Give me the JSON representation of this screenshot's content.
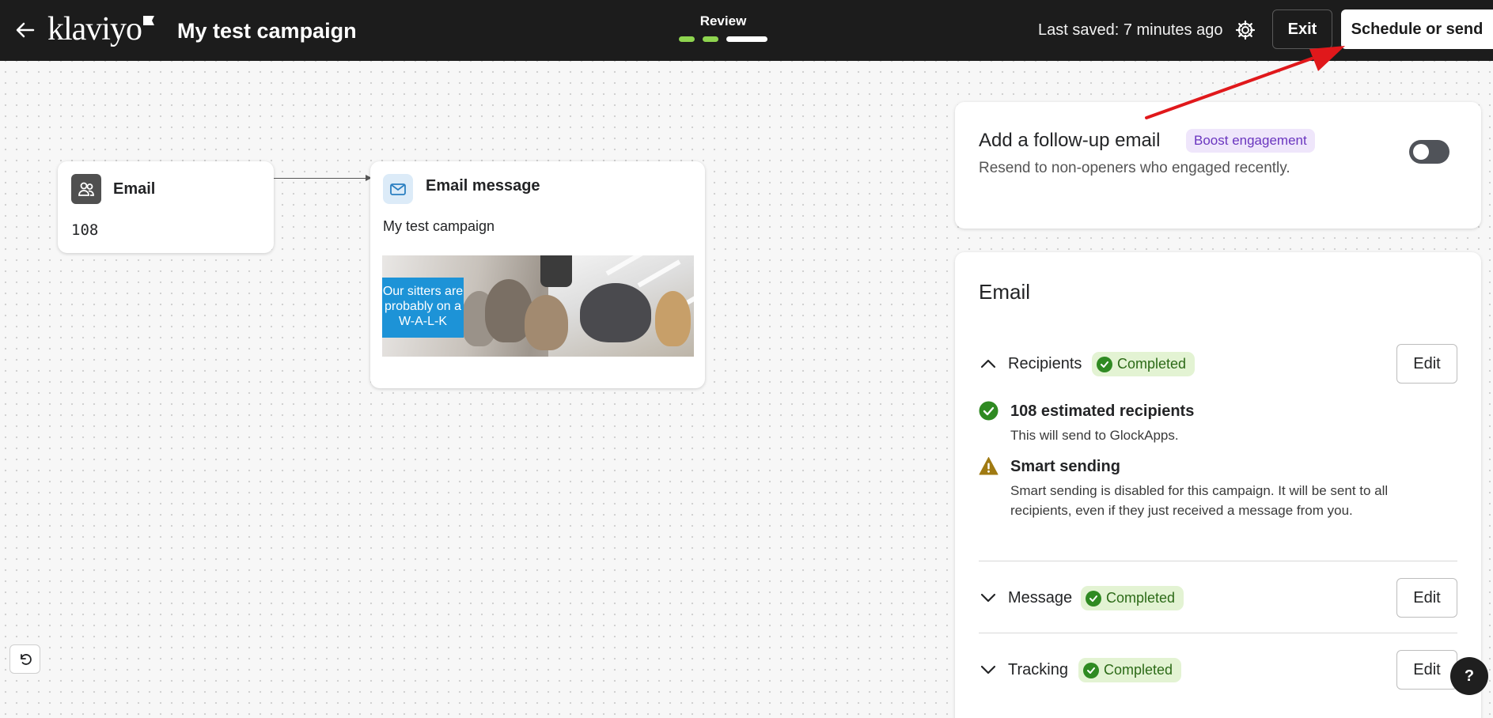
{
  "header": {
    "logo_text": "klaviyo",
    "campaign_title": "My test campaign",
    "progress_label": "Review",
    "progress_steps_done": 2,
    "progress_steps_total": 3,
    "last_saved": "Last saved: 7 minutes ago",
    "exit_label": "Exit",
    "send_label": "Schedule or send"
  },
  "canvas": {
    "audience_node": {
      "title": "Email",
      "count": "108",
      "icon": "audience-icon"
    },
    "message_node": {
      "title": "Email message",
      "subject": "My test campaign",
      "icon": "envelope-icon",
      "preview_text_lines": [
        "Our sitters are",
        "probably on a",
        "W-A-L-K"
      ]
    }
  },
  "followup": {
    "title": "Add a follow-up email",
    "badge": "Boost engagement",
    "description": "Resend to non-openers who engaged recently.",
    "enabled": false
  },
  "email_panel": {
    "heading": "Email",
    "sections": [
      {
        "label": "Recipients",
        "status": "Completed",
        "edit": "Edit",
        "expanded": true
      },
      {
        "label": "Message",
        "status": "Completed",
        "edit": "Edit",
        "expanded": false
      },
      {
        "label": "Tracking",
        "status": "Completed",
        "edit": "Edit",
        "expanded": false
      }
    ],
    "recipient_details": [
      {
        "title": "108 estimated recipients",
        "text": "This will send to GlockApps.",
        "icon": "check-circle-icon"
      },
      {
        "title": "Smart sending",
        "text": "Smart sending is disabled for this campaign. It will be sent to all recipients, even if they just received a message from you.",
        "icon": "warning-icon"
      }
    ]
  },
  "help_label": "?",
  "colors": {
    "topbar": "#1c1c1c",
    "progress_done": "#8ed44f",
    "badge_purple_bg": "#efe6fb",
    "completed_bg": "#e3f3d3",
    "completed_check": "#2f8a22",
    "warning": "#a07a12",
    "annotation_arrow": "#e0181b"
  }
}
